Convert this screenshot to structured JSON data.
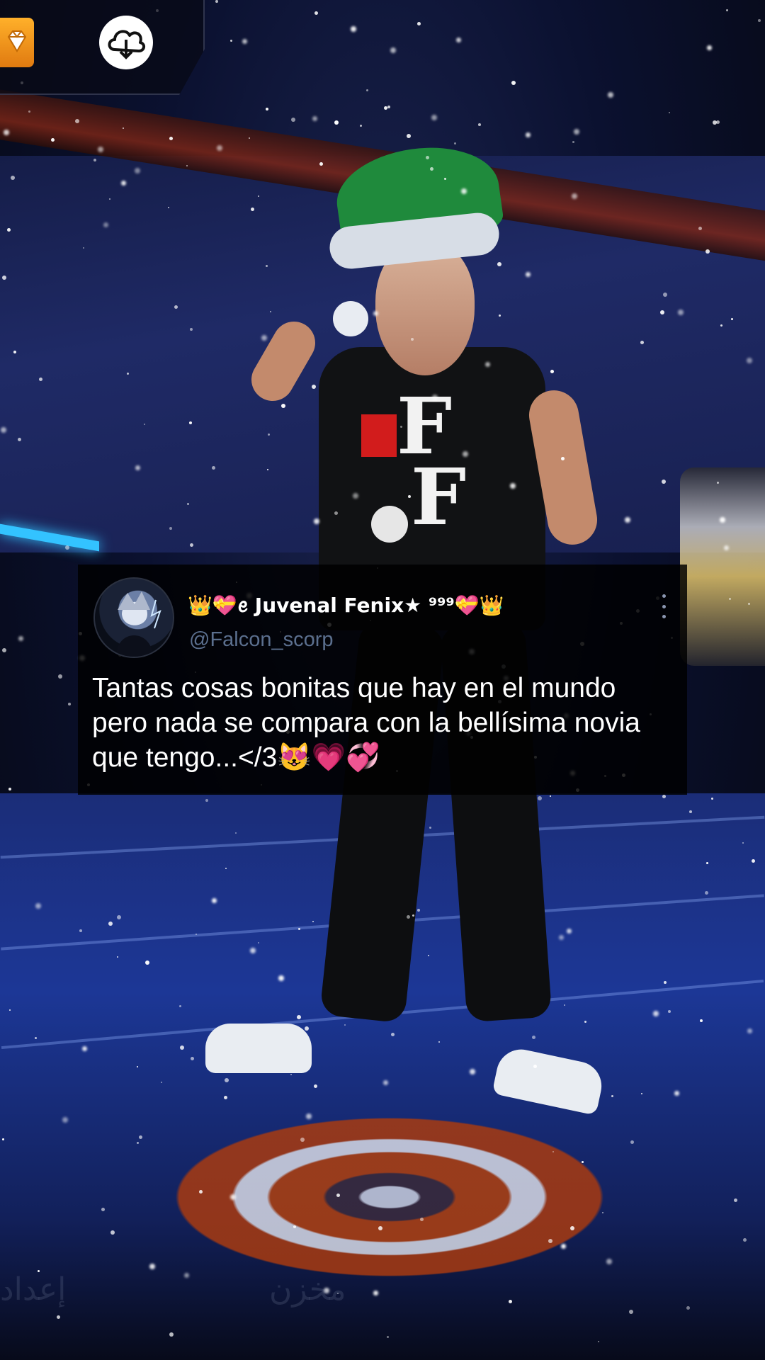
{
  "hud": {
    "diamond_icon": "diamond-icon",
    "cloud_icon": "cloud-download-icon",
    "accent_color": "#ffb02a"
  },
  "tweet": {
    "display_name": "👑💝ꫀ Juvenal Fenix★ ⁹⁹⁹💝👑",
    "handle": "@Falcon_scorp",
    "text": "Tantas cosas bonitas que hay en el mundo pero nada se compara con la bellísima novia que tengo...</3😻💗💞",
    "more_icon": "more-vertical-icon",
    "handle_color": "#5b6f8e"
  },
  "bottom_bar": {
    "left_label": "إعداد",
    "center_label": "مخزن"
  }
}
